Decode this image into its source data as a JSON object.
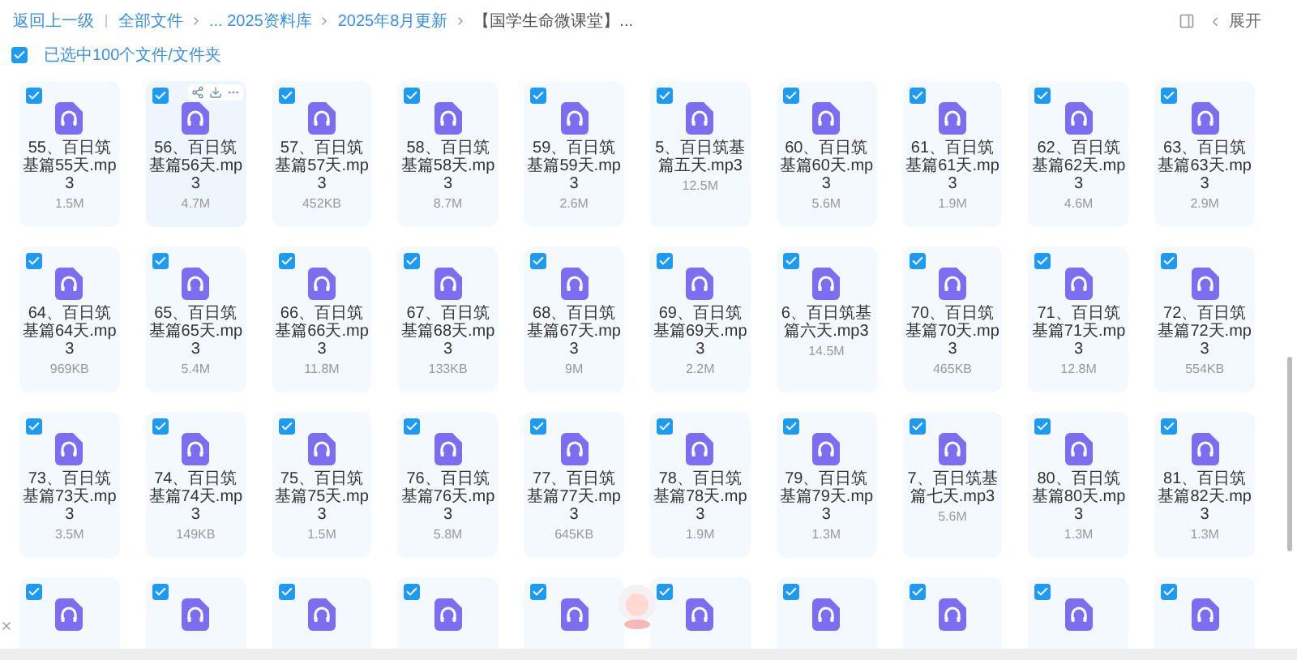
{
  "breadcrumb": {
    "back": "返回上一级",
    "items": [
      {
        "label": "全部文件",
        "current": false
      },
      {
        "label": "... 2025资料库",
        "current": false
      },
      {
        "label": "2025年8月更新",
        "current": false
      },
      {
        "label": "【国学生命微课堂】...",
        "current": true
      }
    ]
  },
  "expand": {
    "label": "展开"
  },
  "selection": {
    "checked": true,
    "label": "已选中100个文件/文件夹"
  },
  "files": [
    {
      "name": "55、百日筑基篇55天.mp3",
      "size": "1.5M",
      "selected": true,
      "hovered": false
    },
    {
      "name": "56、百日筑基篇56天.mp3",
      "size": "4.7M",
      "selected": true,
      "hovered": true
    },
    {
      "name": "57、百日筑基篇57天.mp3",
      "size": "452KB",
      "selected": true,
      "hovered": false
    },
    {
      "name": "58、百日筑基篇58天.mp3",
      "size": "8.7M",
      "selected": true,
      "hovered": false
    },
    {
      "name": "59、百日筑基篇59天.mp3",
      "size": "2.6M",
      "selected": true,
      "hovered": false
    },
    {
      "name": "5、百日筑基篇五天.mp3",
      "size": "12.5M",
      "selected": true,
      "hovered": false
    },
    {
      "name": "60、百日筑基篇60天.mp3",
      "size": "5.6M",
      "selected": true,
      "hovered": false
    },
    {
      "name": "61、百日筑基篇61天.mp3",
      "size": "1.9M",
      "selected": true,
      "hovered": false
    },
    {
      "name": "62、百日筑基篇62天.mp3",
      "size": "4.6M",
      "selected": true,
      "hovered": false
    },
    {
      "name": "63、百日筑基篇63天.mp3",
      "size": "2.9M",
      "selected": true,
      "hovered": false
    },
    {
      "name": "64、百日筑基篇64天.mp3",
      "size": "969KB",
      "selected": true,
      "hovered": false
    },
    {
      "name": "65、百日筑基篇65天.mp3",
      "size": "5.4M",
      "selected": true,
      "hovered": false
    },
    {
      "name": "66、百日筑基篇66天.mp3",
      "size": "11.8M",
      "selected": true,
      "hovered": false
    },
    {
      "name": "67、百日筑基篇68天.mp3",
      "size": "133KB",
      "selected": true,
      "hovered": false
    },
    {
      "name": "68、百日筑基篇67天.mp3",
      "size": "9M",
      "selected": true,
      "hovered": false
    },
    {
      "name": "69、百日筑基篇69天.mp3",
      "size": "2.2M",
      "selected": true,
      "hovered": false
    },
    {
      "name": "6、百日筑基篇六天.mp3",
      "size": "14.5M",
      "selected": true,
      "hovered": false
    },
    {
      "name": "70、百日筑基篇70天.mp3",
      "size": "465KB",
      "selected": true,
      "hovered": false
    },
    {
      "name": "71、百日筑基篇71天.mp3",
      "size": "12.8M",
      "selected": true,
      "hovered": false
    },
    {
      "name": "72、百日筑基篇72天.mp3",
      "size": "554KB",
      "selected": true,
      "hovered": false
    },
    {
      "name": "73、百日筑基篇73天.mp3",
      "size": "3.5M",
      "selected": true,
      "hovered": false
    },
    {
      "name": "74、百日筑基篇74天.mp3",
      "size": "149KB",
      "selected": true,
      "hovered": false
    },
    {
      "name": "75、百日筑基篇75天.mp3",
      "size": "1.5M",
      "selected": true,
      "hovered": false
    },
    {
      "name": "76、百日筑基篇76天.mp3",
      "size": "5.8M",
      "selected": true,
      "hovered": false
    },
    {
      "name": "77、百日筑基篇77天.mp3",
      "size": "645KB",
      "selected": true,
      "hovered": false
    },
    {
      "name": "78、百日筑基篇78天.mp3",
      "size": "1.9M",
      "selected": true,
      "hovered": false
    },
    {
      "name": "79、百日筑基篇79天.mp3",
      "size": "1.3M",
      "selected": true,
      "hovered": false
    },
    {
      "name": "7、百日筑基篇七天.mp3",
      "size": "5.6M",
      "selected": true,
      "hovered": false
    },
    {
      "name": "80、百日筑基篇80天.mp3",
      "size": "1.3M",
      "selected": true,
      "hovered": false
    },
    {
      "name": "81、百日筑基篇82天.mp3",
      "size": "1.3M",
      "selected": true,
      "hovered": false
    },
    {
      "selected": true,
      "hovered": false
    },
    {
      "selected": true,
      "hovered": false
    },
    {
      "selected": true,
      "hovered": false
    },
    {
      "selected": true,
      "hovered": false
    },
    {
      "selected": true,
      "hovered": false
    },
    {
      "selected": true,
      "hovered": false
    },
    {
      "selected": true,
      "hovered": false
    },
    {
      "selected": true,
      "hovered": false
    },
    {
      "selected": true,
      "hovered": false
    },
    {
      "selected": true,
      "hovered": false
    }
  ]
}
